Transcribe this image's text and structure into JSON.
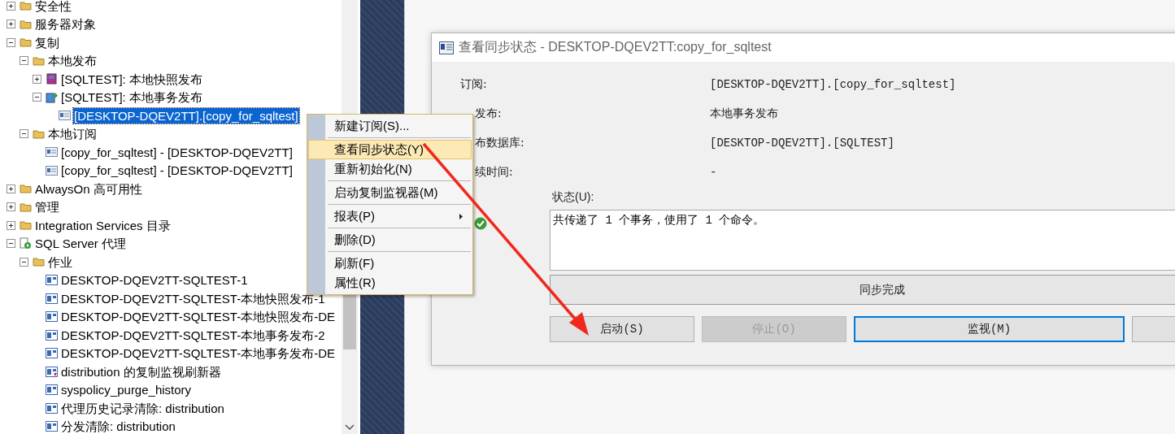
{
  "tree": [
    {
      "label": "安全性",
      "kind": "folder",
      "expanded": false
    },
    {
      "label": "服务器对象",
      "kind": "folder",
      "expanded": false
    },
    {
      "label": "复制",
      "kind": "folder",
      "expanded": true,
      "children": [
        {
          "label": "本地发布",
          "kind": "folder",
          "expanded": true,
          "children": [
            {
              "label": "[SQLTEST]: 本地快照发布",
              "kind": "snapshot",
              "expanded": false
            },
            {
              "label": "[SQLTEST]: 本地事务发布",
              "kind": "transaction",
              "expanded": true,
              "children": [
                {
                  "label": "[DESKTOP-DQEV2TT].[copy_for_sqltest]",
                  "kind": "subscription",
                  "selected": true
                }
              ]
            }
          ]
        },
        {
          "label": "本地订阅",
          "kind": "folder",
          "expanded": true,
          "children": [
            {
              "label": "[copy_for_sqltest] - [DESKTOP-DQEV2TT]",
              "kind": "subscription",
              "selected": false
            },
            {
              "label": "[copy_for_sqltest] - [DESKTOP-DQEV2TT]",
              "kind": "subscription",
              "selected": false
            }
          ]
        }
      ]
    },
    {
      "label": "AlwaysOn 高可用性",
      "kind": "folder",
      "expanded": false
    },
    {
      "label": "管理",
      "kind": "folder",
      "expanded": false
    },
    {
      "label": "Integration Services 目录",
      "kind": "folder",
      "expanded": false
    },
    {
      "label": "SQL Server 代理",
      "kind": "agent",
      "expanded": true,
      "children": [
        {
          "label": "作业",
          "kind": "folder",
          "expanded": true,
          "children": [
            {
              "label": "DESKTOP-DQEV2TT-SQLTEST-1",
              "kind": "job",
              "selected": false
            },
            {
              "label": "DESKTOP-DQEV2TT-SQLTEST-本地快照发布-1",
              "kind": "job",
              "selected": false
            },
            {
              "label": "DESKTOP-DQEV2TT-SQLTEST-本地快照发布-DE",
              "kind": "job",
              "selected": false
            },
            {
              "label": "DESKTOP-DQEV2TT-SQLTEST-本地事务发布-2",
              "kind": "job",
              "selected": false
            },
            {
              "label": "DESKTOP-DQEV2TT-SQLTEST-本地事务发布-DE",
              "kind": "job",
              "selected": false
            },
            {
              "label": "distribution 的复制监视刷新器",
              "kind": "job-error",
              "selected": false
            },
            {
              "label": "syspolicy_purge_history",
              "kind": "job",
              "selected": false
            },
            {
              "label": "代理历史记录清除: distribution",
              "kind": "job",
              "selected": false
            },
            {
              "label": "分发清除: distribution",
              "kind": "job",
              "selected": false
            }
          ]
        }
      ]
    }
  ],
  "context_menu": [
    {
      "kind": "item",
      "label": "新建订阅(S)...",
      "selected": false
    },
    {
      "kind": "separator"
    },
    {
      "kind": "item",
      "label": "查看同步状态(Y)",
      "selected": true
    },
    {
      "kind": "item",
      "label": "重新初始化(N)",
      "selected": false
    },
    {
      "kind": "separator"
    },
    {
      "kind": "item",
      "label": "启动复制监视器(M)",
      "selected": false
    },
    {
      "kind": "separator"
    },
    {
      "kind": "item",
      "label": "报表(P)",
      "selected": false,
      "submenu": true
    },
    {
      "kind": "separator"
    },
    {
      "kind": "item",
      "label": "删除(D)",
      "selected": false
    },
    {
      "kind": "separator"
    },
    {
      "kind": "item",
      "label": "刷新(F)",
      "selected": false
    },
    {
      "kind": "item",
      "label": "属性(R)",
      "selected": false
    }
  ],
  "dialog": {
    "title": "查看同步状态 - DESKTOP-DQEV2TT:copy_for_sqltest",
    "fields": [
      {
        "label": "订阅:",
        "value": "[DESKTOP-DQEV2TT].[copy_for_sqltest]",
        "cut": false
      },
      {
        "label": "发布:",
        "value": "本地事务发布",
        "cut": true
      },
      {
        "label": "布数据库:",
        "value": "[DESKTOP-DQEV2TT].[SQLTEST]",
        "cut": true
      },
      {
        "label": "续时间:",
        "value": "-",
        "cut": true
      }
    ],
    "status_label": "状态(U):",
    "status_text": "共传递了 1 个事务，使用了 1 个命令。",
    "progress_text": "同步完成",
    "buttons": [
      {
        "label": "启动(S)",
        "disabled": false,
        "focused": false
      },
      {
        "label": "停止(O)",
        "disabled": true,
        "focused": false
      },
      {
        "label": "监视(M)",
        "disabled": false,
        "focused": true
      }
    ]
  }
}
